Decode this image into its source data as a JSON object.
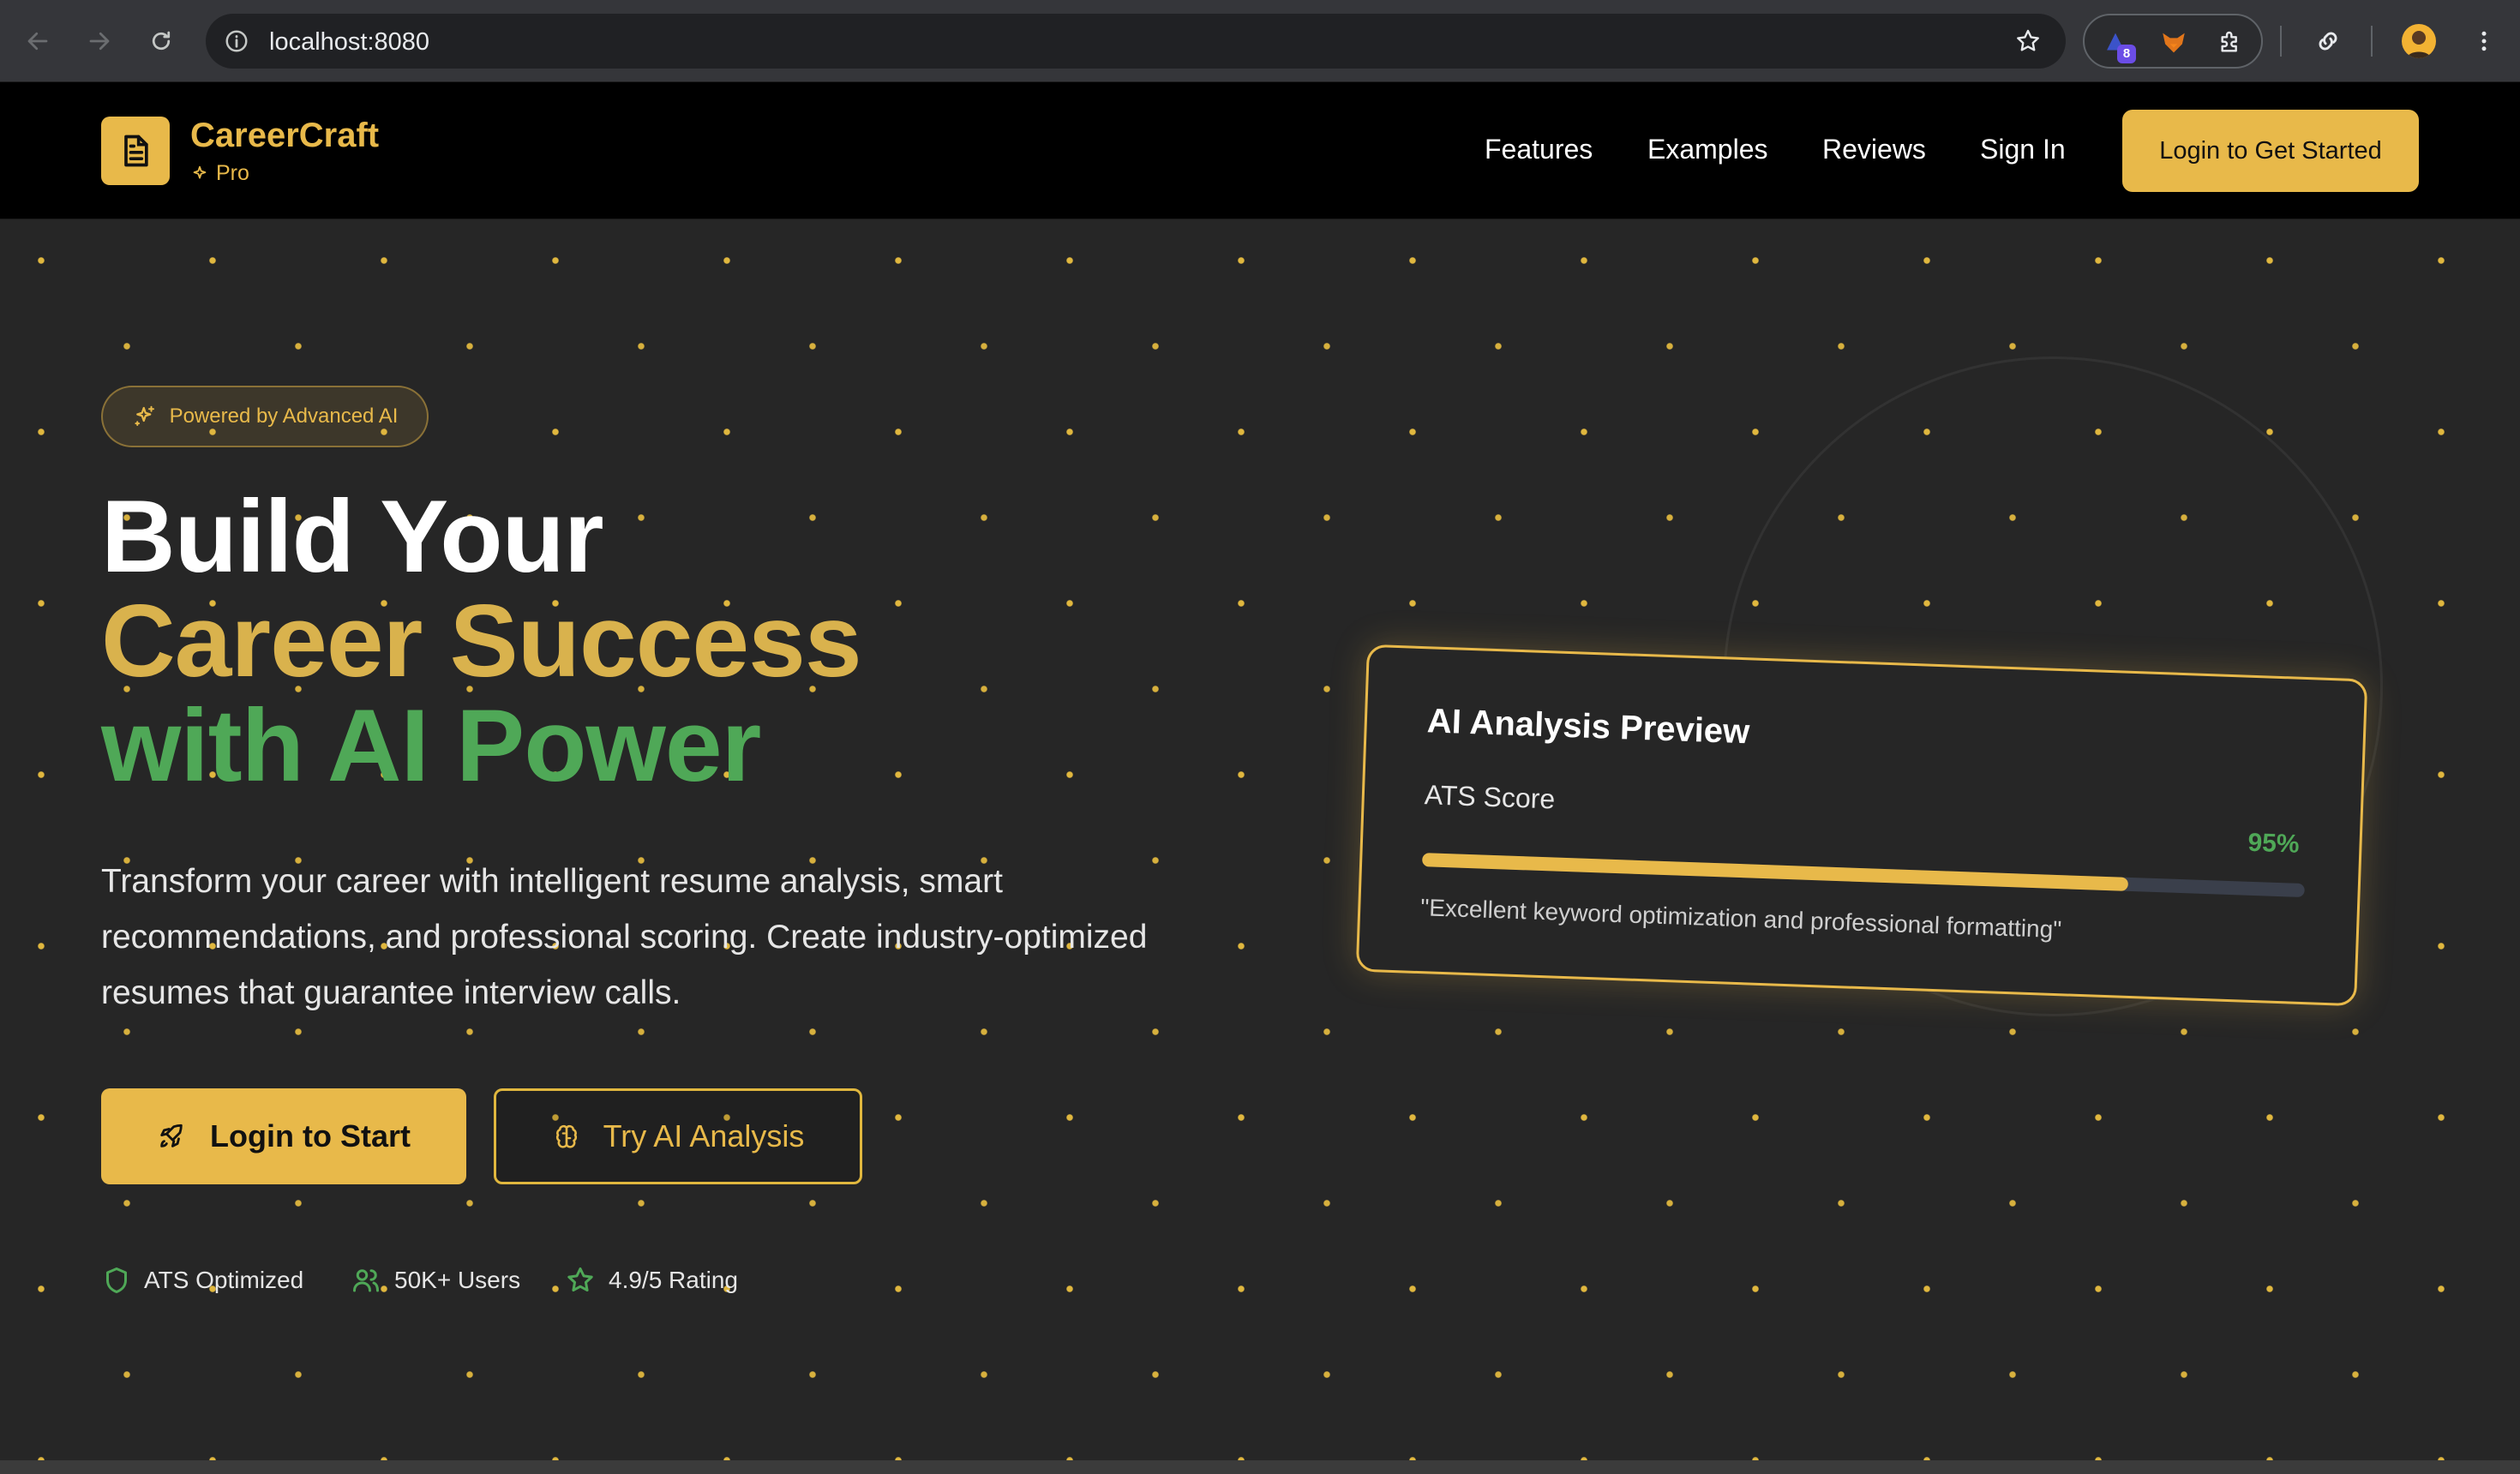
{
  "browser": {
    "url": "localhost:8080",
    "extension_badge": "8"
  },
  "header": {
    "brand": "CareerCraft",
    "tier": "Pro",
    "nav": [
      "Features",
      "Examples",
      "Reviews",
      "Sign In"
    ],
    "cta": "Login to Get Started"
  },
  "hero": {
    "badge": "Powered by Advanced AI",
    "title_line1": "Build Your",
    "title_line2": "Career Success",
    "title_line3": "with AI Power",
    "description": "Transform your career with intelligent resume analysis, smart recommendations, and professional scoring. Create industry-optimized resumes that guarantee interview calls.",
    "primary_button": "Login to Start",
    "secondary_button": "Try AI Analysis",
    "stats": [
      "ATS Optimized",
      "50K+ Users",
      "4.9/5 Rating"
    ]
  },
  "preview": {
    "title": "AI Analysis Preview",
    "score_label": "ATS Score",
    "score_value": "95%",
    "score_fraction": 0.8,
    "quote": "\"Excellent keyword optimization and professional formatting\""
  },
  "colors": {
    "accent_gold": "#e8b94a",
    "accent_green": "#4fa857",
    "background": "#262626",
    "header_bg": "#000000"
  },
  "icons": {
    "logo": "document-icon",
    "pro": "sparkle-icon",
    "badge": "sparkles-icon",
    "primary_button": "rocket-icon",
    "secondary_button": "brain-icon",
    "stat1": "shield-icon",
    "stat2": "users-icon",
    "stat3": "star-icon"
  }
}
